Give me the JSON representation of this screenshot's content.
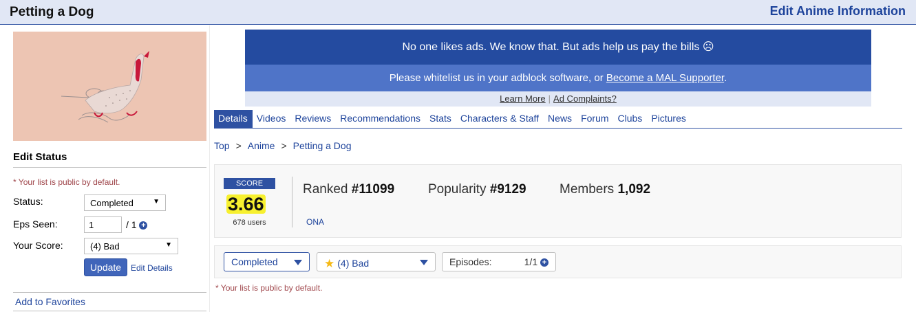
{
  "header": {
    "title": "Petting a Dog",
    "edit_link": "Edit Anime Information"
  },
  "sidebar": {
    "edit_status_heading": "Edit Status",
    "public_note": "* Your list is public by default.",
    "status_label": "Status:",
    "status_value": "Completed",
    "eps_label": "Eps Seen:",
    "eps_value": "1",
    "eps_total": "/ 1",
    "score_label": "Your Score:",
    "score_value": "(4) Bad",
    "update_button": "Update",
    "edit_details": "Edit Details",
    "add_favorites": "Add to Favorites"
  },
  "ad": {
    "line1": "No one likes ads. We know that. But ads help us pay the bills ☹",
    "line2_prefix": "Please whitelist us in your adblock software, or",
    "line2_link": "Become a MAL Supporter",
    "line2_suffix": ".",
    "learn_more": "Learn More",
    "separator": "|",
    "complaints": "Ad Complaints?"
  },
  "tabs": [
    {
      "label": "Details",
      "active": true
    },
    {
      "label": "Videos"
    },
    {
      "label": "Reviews"
    },
    {
      "label": "Recommendations"
    },
    {
      "label": "Stats"
    },
    {
      "label": "Characters & Staff"
    },
    {
      "label": "News"
    },
    {
      "label": "Forum"
    },
    {
      "label": "Clubs"
    },
    {
      "label": "Pictures"
    }
  ],
  "breadcrumb": {
    "items": [
      "Top",
      "Anime",
      "Petting a Dog"
    ],
    "separator": ">"
  },
  "stats": {
    "score_label": "SCORE",
    "score_value": "3.66",
    "score_users": "678 users",
    "ranked_label": "Ranked",
    "ranked_value": "#11099",
    "popularity_label": "Popularity",
    "popularity_value": "#9129",
    "members_label": "Members",
    "members_value": "1,092",
    "media_type": "ONA"
  },
  "list_bar": {
    "status": "Completed",
    "score": "(4) Bad",
    "episodes_label": "Episodes:",
    "episodes_value": "1/1"
  },
  "footer_note": "* Your list is public by default.",
  "colors": {
    "brand_blue": "#2e51a2",
    "link_blue": "#1d439b",
    "header_bg": "#e1e7f5",
    "ad_dark": "#244ba0",
    "ad_light": "#4f74c8",
    "score_highlight": "#f7f02f",
    "note_red": "#a0474c"
  }
}
